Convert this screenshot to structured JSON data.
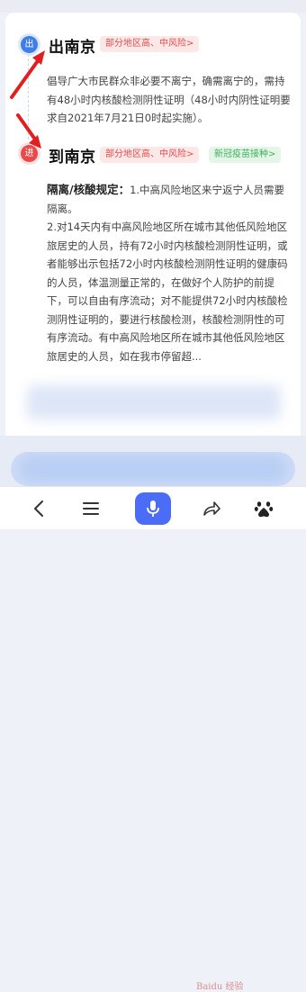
{
  "departure": {
    "badge": "出",
    "title": "出南京",
    "risk_tag": "部分地区高、中风险>",
    "notice": "倡导广大市民群众非必要不离宁，确需离宁的，需持有48小时内核酸检测阴性证明（48小时内阴性证明要求自2021年7月21日0时起实施）。"
  },
  "arrival": {
    "badge": "进",
    "title": "到南京",
    "risk_tag": "部分地区高、中风险>",
    "vaccine_tag": "新冠疫苗接种>",
    "rule_label": "隔离/核酸规定：",
    "rule_text_1": "1.中高风险地区来宁返宁人员需要隔离。",
    "rule_text_2": "2.对14天内有中高风险地区所在城市其他低风险地区旅居史的人员，持有72小时内核酸检测阴性证明，或者能够出示包括72小时内核酸检测阴性证明的健康码的人员，体温测量正常的，在做好个人防护的前提下，可以自由有序流动；对不能提供72小时内核酸检测阴性证明的，要进行核酸检测，核酸检测阴性的可有序流动。有中高风险地区所在城市其他低风险地区旅居史的人员，如在我市停留超..."
  },
  "bottom_nav": {
    "back_icon": "chevron-left-icon",
    "menu_icon": "hamburger-menu-icon",
    "voice_icon": "microphone-icon",
    "share_icon": "share-arrow-icon",
    "logo_icon": "baidu-paw-icon",
    "watermark": "Baidu 经验"
  },
  "colors": {
    "departure_dot": "#3f7de9",
    "arrival_dot": "#e84a4a",
    "risk_tag_text": "#e34c4c",
    "vaccine_tag_text": "#3fae5a",
    "voice_button": "#4a6cf7",
    "annotation_arrow": "#e02020"
  }
}
